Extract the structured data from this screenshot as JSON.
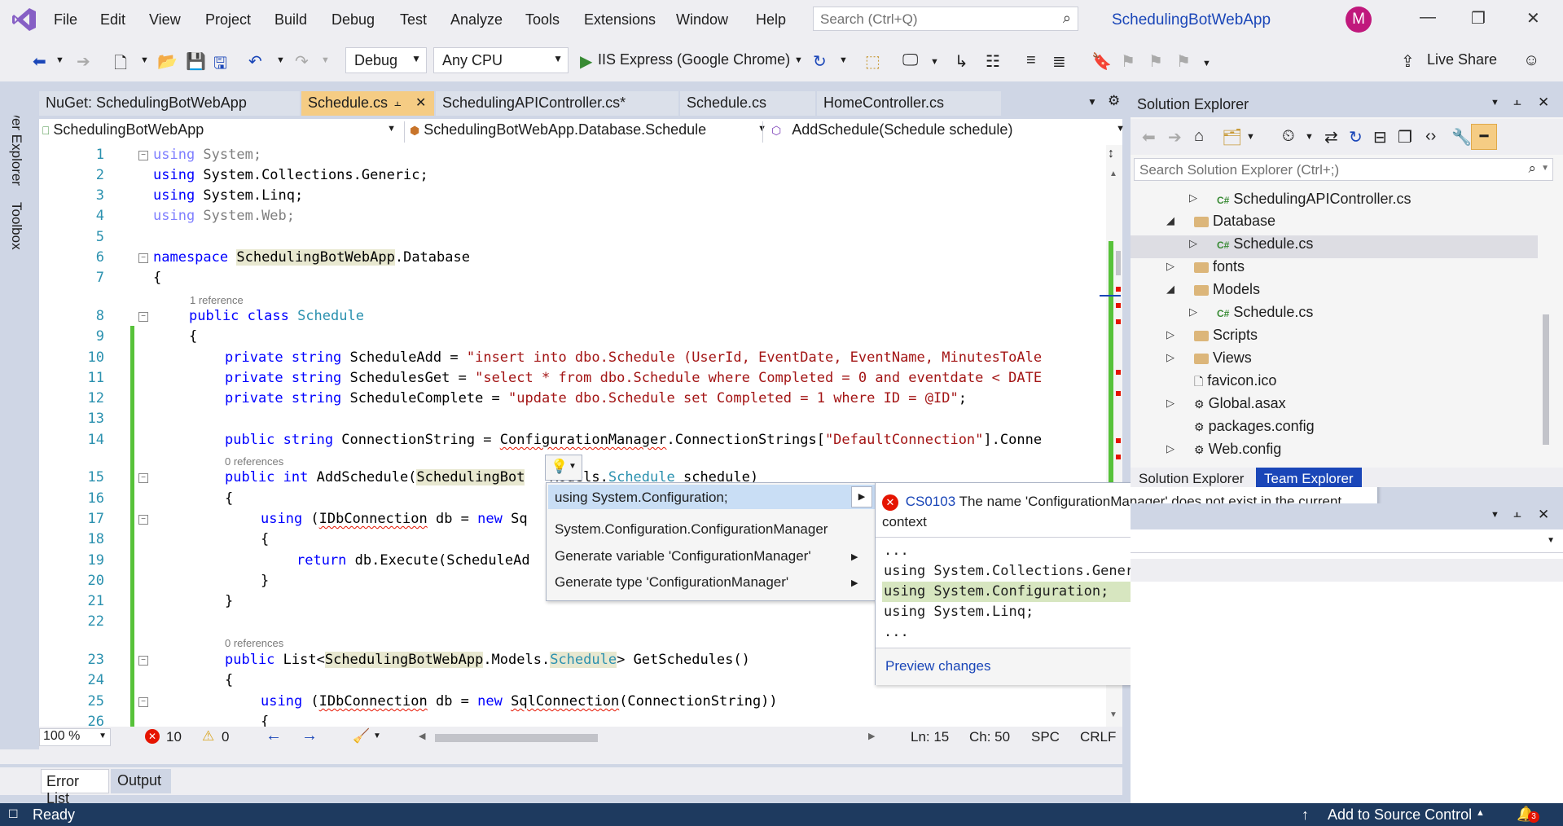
{
  "menu": {
    "items": [
      "File",
      "Edit",
      "View",
      "Project",
      "Build",
      "Debug",
      "Test",
      "Analyze",
      "Tools",
      "Extensions",
      "Window",
      "Help"
    ],
    "search_placeholder": "Search (Ctrl+Q)",
    "solution_name": "SchedulingBotWebApp",
    "avatar_initial": "M"
  },
  "toolbar": {
    "config": "Debug",
    "platform": "Any CPU",
    "run_target": "IIS Express (Google Chrome)",
    "live_share": "Live Share"
  },
  "tabs": [
    {
      "label": "NuGet: SchedulingBotWebApp"
    },
    {
      "label": "Schedule.cs"
    },
    {
      "label": "SchedulingAPIController.cs*"
    },
    {
      "label": "Schedule.cs"
    },
    {
      "label": "HomeController.cs"
    }
  ],
  "navbar": {
    "project": "SchedulingBotWebApp",
    "type": "SchedulingBotWebApp.Database.Schedule",
    "member": "AddSchedule(Schedule schedule)"
  },
  "side": {
    "server_explorer": "Server Explorer",
    "toolbox": "Toolbox"
  },
  "code": {
    "line_numbers": [
      "1",
      "2",
      "3",
      "4",
      "5",
      "6",
      "7",
      "8",
      "9",
      "10",
      "11",
      "12",
      "13",
      "14",
      "15",
      "16",
      "17",
      "18",
      "19",
      "20",
      "21",
      "22",
      "23",
      "24",
      "25",
      "26"
    ],
    "ref1": "1 reference",
    "ref0a": "0 references",
    "ref0b": "0 references",
    "l1a": "using",
    "l1b": " System;",
    "l2a": "using",
    "l2b": " System.Collections.Generic;",
    "l3a": "using",
    "l3b": " System.Linq;",
    "l4a": "using",
    "l4b": " System.Web;",
    "l6a": "namespace",
    "l6b": "SchedulingBotWebApp",
    "l6c": ".Database",
    "l7": "{",
    "l8a": "public class",
    "l8b": "Schedule",
    "l9": "{",
    "l10a": "private string",
    "l10b": "ScheduleAdd",
    "l10c": " = ",
    "l10d": "\"insert into dbo.Schedule (UserId, EventDate, EventName, MinutesToAle",
    "l11a": "private string",
    "l11b": "SchedulesGet",
    "l11c": " = ",
    "l11d": "\"select * from dbo.Schedule where Completed = 0 and eventdate < DATE",
    "l12a": "private string",
    "l12b": "ScheduleComplete",
    "l12c": " = ",
    "l12d": "\"update dbo.Schedule set Completed = 1 where ID = @ID\"",
    "l12e": ";",
    "l14a": "public string",
    "l14b": " ConnectionString = ",
    "l14c": "ConfigurationManager",
    "l14d": ".ConnectionStrings[",
    "l14e": "\"DefaultConnection\"",
    "l14f": "].Conne",
    "l15a": "public int",
    "l15b": " AddSchedule(",
    "l15c": "SchedulingBot",
    "l15d": "   Models.",
    "l15e": "Schedule",
    "l15f": " schedule)",
    "l16": "{",
    "l17a": "using",
    "l17b": " (",
    "l17c": "IDbConnection",
    "l17d": " db = ",
    "l17e": "new",
    "l17f": " Sq",
    "l18": "{",
    "l19a": "return",
    "l19b": " db.Execute(ScheduleAd",
    "l20": "}",
    "l21": "}",
    "l23a": "public",
    "l23b": " List<",
    "l23c": "SchedulingBotWebApp",
    "l23d": ".Models.",
    "l23e": "Schedule",
    "l23f": "> GetSchedules()",
    "l24": "{",
    "l25a": "using",
    "l25b": " (",
    "l25c": "IDbConnection",
    "l25d": " db = ",
    "l25e": "new",
    "l25f": " ",
    "l25g": "SqlConnection",
    "l25h": "(ConnectionString))",
    "l26": "{"
  },
  "quick_actions": {
    "items": [
      "using System.Configuration;",
      "System.Configuration.ConfigurationManager",
      "Generate variable 'ConfigurationManager'",
      "Generate type 'ConfigurationManager'"
    ]
  },
  "preview": {
    "error_code": "CS0103",
    "error_message": "The name 'ConfigurationManager' does not exist in the current context",
    "lines": [
      "...",
      "using System.Collections.Generic;",
      "using System.Configuration;",
      "using System.Linq;",
      "..."
    ],
    "preview_link": "Preview changes"
  },
  "editor_status": {
    "zoom": "100 %",
    "errors": "10",
    "warnings": "0",
    "ln": "Ln: 15",
    "ch": "Ch: 50",
    "spc": "SPC",
    "crlf": "CRLF"
  },
  "bottom_tabs": [
    "Error List",
    "Output"
  ],
  "status": {
    "ready": "Ready",
    "source_control": "Add to Source Control",
    "notifications": "3"
  },
  "solution_explorer": {
    "title": "Solution Explorer",
    "search_placeholder": "Search Solution Explorer (Ctrl+;)",
    "items": [
      "SchedulingAPIController.cs",
      "Database",
      "Schedule.cs",
      "fonts",
      "Models",
      "Schedule.cs",
      "Scripts",
      "Views",
      "favicon.ico",
      "Global.asax",
      "packages.config",
      "Web.config"
    ],
    "bottom_tabs": [
      "Solution Explorer",
      "Team Explorer"
    ]
  },
  "colors": {
    "accent": "#1a46b8",
    "active_tab": "#f5cc84",
    "status_bar": "#1e3a5f",
    "error": "#e51400"
  }
}
